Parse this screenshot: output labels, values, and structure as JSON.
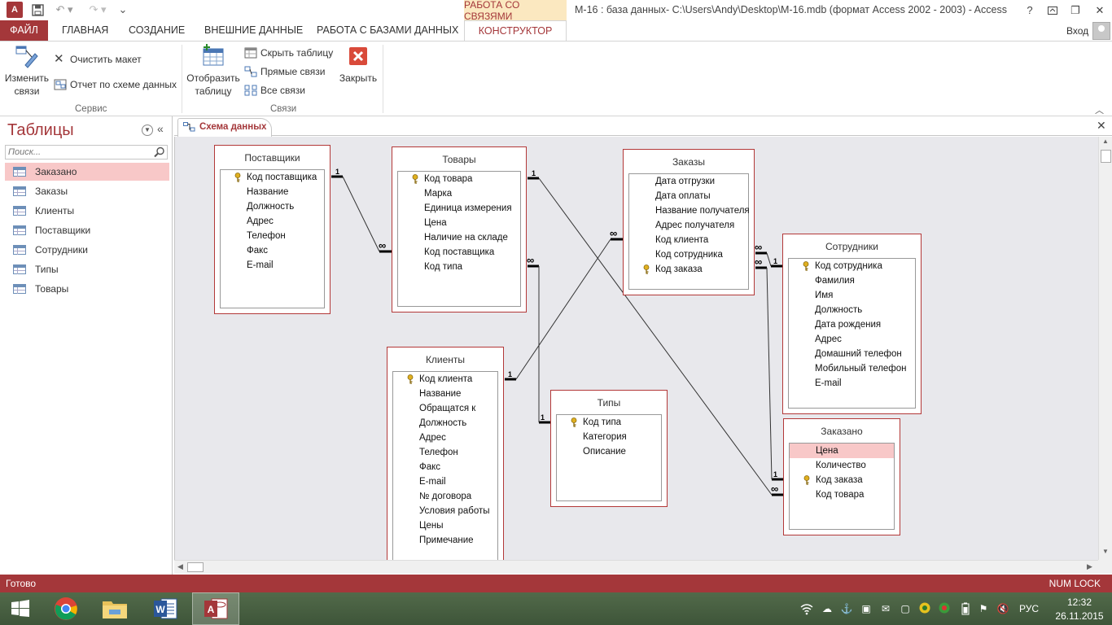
{
  "window": {
    "title": "М-16 : база данных- C:\\Users\\Andy\\Desktop\\М-16.mdb (формат Access 2002 - 2003) - Access",
    "context_tab_group": "РАБОТА СО СВЯЗЯМИ",
    "sign_in": "Вход",
    "app_icon_text": "A",
    "help_glyph": "?",
    "restore_glyph": "❐",
    "close_glyph": "✕"
  },
  "tabs": {
    "file": "ФАЙЛ",
    "home": "ГЛАВНАЯ",
    "create": "СОЗДАНИЕ",
    "external": "ВНЕШНИЕ ДАННЫЕ",
    "dbtools": "РАБОТА С БАЗАМИ ДАННЫХ",
    "constructor": "КОНСТРУКТОР"
  },
  "ribbon": {
    "edit_links": "Изменить связи",
    "clear_layout": "Очистить макет",
    "report": "Отчет по схеме данных",
    "group_service": "Сервис",
    "show_table": "Отобразить таблицу",
    "hide_table": "Скрыть таблицу",
    "direct_links": "Прямые связи",
    "all_links": "Все связи",
    "close": "Закрыть",
    "group_links": "Связи"
  },
  "nav": {
    "title": "Таблицы",
    "search_placeholder": "Поиск...",
    "items": [
      {
        "label": "Заказано",
        "selected": true
      },
      {
        "label": "Заказы",
        "selected": false
      },
      {
        "label": "Клиенты",
        "selected": false
      },
      {
        "label": "Поставщики",
        "selected": false
      },
      {
        "label": "Сотрудники",
        "selected": false
      },
      {
        "label": "Типы",
        "selected": false
      },
      {
        "label": "Товары",
        "selected": false
      }
    ]
  },
  "document": {
    "tab_label": "Схема данных"
  },
  "tables": {
    "suppliers": {
      "title": "Поставщики",
      "fields": [
        {
          "name": "Код поставщика",
          "key": true
        },
        {
          "name": "Название",
          "key": false
        },
        {
          "name": "Должность",
          "key": false
        },
        {
          "name": "Адрес",
          "key": false
        },
        {
          "name": "Телефон",
          "key": false
        },
        {
          "name": "Факс",
          "key": false
        },
        {
          "name": "E-mail",
          "key": false
        }
      ]
    },
    "products": {
      "title": "Товары",
      "fields": [
        {
          "name": "Код товара",
          "key": true
        },
        {
          "name": "Марка",
          "key": false
        },
        {
          "name": "Единица измерения",
          "key": false
        },
        {
          "name": "Цена",
          "key": false
        },
        {
          "name": "Наличие на складе",
          "key": false
        },
        {
          "name": "Код поставщика",
          "key": false
        },
        {
          "name": "Код типа",
          "key": false
        }
      ]
    },
    "orders": {
      "title": "Заказы",
      "fields": [
        {
          "name": "Дата отгрузки",
          "key": false
        },
        {
          "name": "Дата оплаты",
          "key": false
        },
        {
          "name": "Название получателя",
          "key": false
        },
        {
          "name": "Адрес получателя",
          "key": false
        },
        {
          "name": "Код клиента",
          "key": false
        },
        {
          "name": "Код сотрудника",
          "key": false
        },
        {
          "name": "Код заказа",
          "key": true
        }
      ]
    },
    "employees": {
      "title": "Сотрудники",
      "fields": [
        {
          "name": "Код сотрудника",
          "key": true
        },
        {
          "name": "Фамилия",
          "key": false
        },
        {
          "name": "Имя",
          "key": false
        },
        {
          "name": "Должность",
          "key": false
        },
        {
          "name": "Дата рождения",
          "key": false
        },
        {
          "name": "Адрес",
          "key": false
        },
        {
          "name": "Домашний телефон",
          "key": false
        },
        {
          "name": "Мобильный телефон",
          "key": false
        },
        {
          "name": "E-mail",
          "key": false
        }
      ]
    },
    "clients": {
      "title": "Клиенты",
      "fields": [
        {
          "name": "Код клиента",
          "key": true
        },
        {
          "name": "Название",
          "key": false
        },
        {
          "name": "Обращатся к",
          "key": false
        },
        {
          "name": "Должность",
          "key": false
        },
        {
          "name": "Адрес",
          "key": false
        },
        {
          "name": "Телефон",
          "key": false
        },
        {
          "name": "Факс",
          "key": false
        },
        {
          "name": "E-mail",
          "key": false
        },
        {
          "name": "№ договора",
          "key": false
        },
        {
          "name": "Условия работы",
          "key": false
        },
        {
          "name": "Цены",
          "key": false
        },
        {
          "name": "Примечание",
          "key": false
        }
      ]
    },
    "types": {
      "title": "Типы",
      "fields": [
        {
          "name": "Код типа",
          "key": true
        },
        {
          "name": "Категория",
          "key": false
        },
        {
          "name": "Описание",
          "key": false
        }
      ]
    },
    "ordered": {
      "title": "Заказано",
      "fields": [
        {
          "name": "Цена",
          "key": false,
          "selected": true
        },
        {
          "name": "Количество",
          "key": false
        },
        {
          "name": "Код заказа",
          "key": true
        },
        {
          "name": "Код товара",
          "key": false
        }
      ]
    }
  },
  "relationships": {
    "one_label": "1",
    "many_label": "∞"
  },
  "status": {
    "text": "Готово",
    "numlock": "NUM LOCK"
  },
  "taskbar": {
    "lang": "РУС",
    "time": "12:32",
    "date": "26.11.2015"
  }
}
